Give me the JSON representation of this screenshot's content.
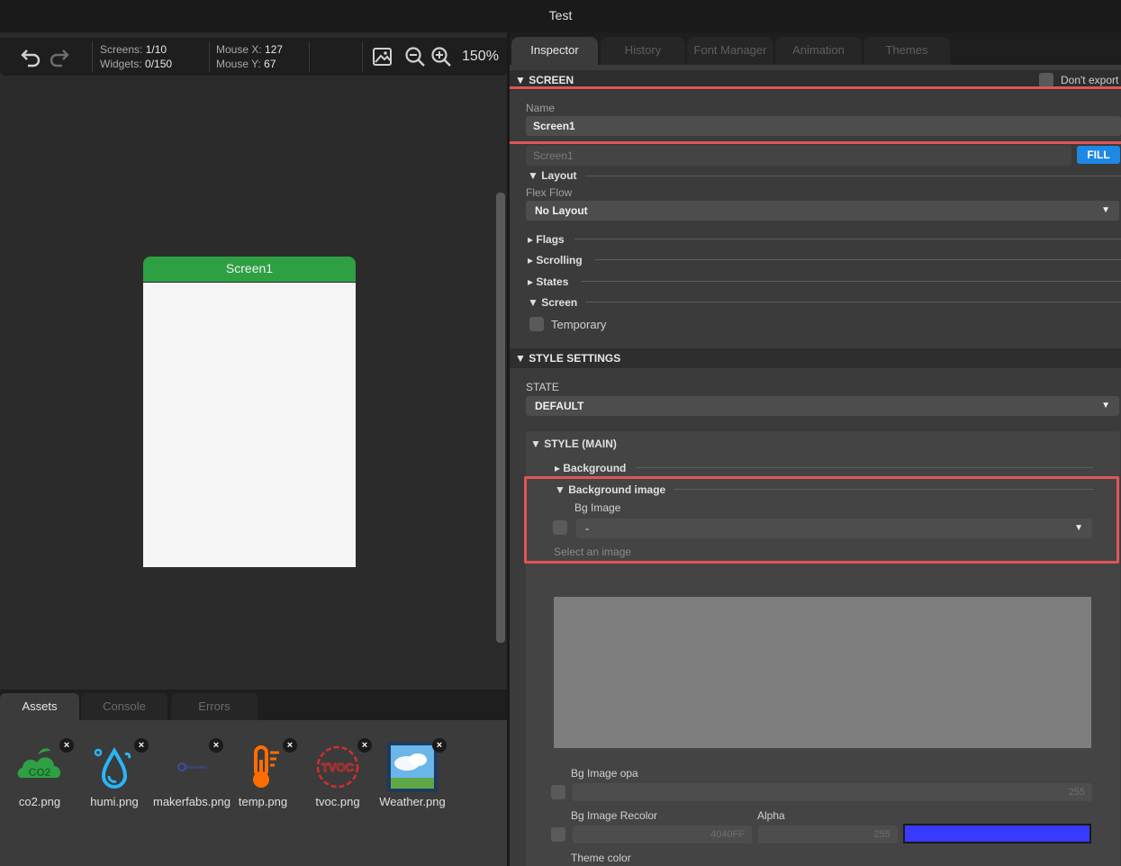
{
  "window": {
    "title": "Test"
  },
  "toolbar": {
    "screens_label": "Screens:",
    "screens_value": "1/10",
    "widgets_label": "Widgets:",
    "widgets_value": "0/150",
    "mouse_x_label": "Mouse X:",
    "mouse_x_value": "127",
    "mouse_y_label": "Mouse Y:",
    "mouse_y_value": "67",
    "zoom": "150%",
    "icons": [
      "undo-icon",
      "redo-icon",
      "image-icon",
      "zoom-out-icon",
      "zoom-in-icon"
    ]
  },
  "canvas": {
    "screen_name": "Screen1",
    "header_color": "#2ea043"
  },
  "bottom": {
    "tabs": [
      "Assets",
      "Console",
      "Errors"
    ],
    "active_tab": "Assets",
    "assets": [
      {
        "name": "co2.png",
        "icon": "co2-icon"
      },
      {
        "name": "humi.png",
        "icon": "humidity-icon"
      },
      {
        "name": "makerfabs.png",
        "icon": "makerfabs-logo-icon"
      },
      {
        "name": "temp.png",
        "icon": "thermometer-icon"
      },
      {
        "name": "tvoc.png",
        "icon": "tvoc-icon"
      },
      {
        "name": "Weather.png",
        "icon": "weather-icon"
      }
    ],
    "makerfabs_logo_text": "Makerfabs",
    "tvoc_logo_text": "TVOC",
    "co2_logo_text": "CO2",
    "close_glyph": "×"
  },
  "inspector": {
    "tabs": [
      "Inspector",
      "History",
      "Font Manager",
      "Animation",
      "Themes"
    ],
    "active_tab": "Inspector",
    "screen_section": "▼ SCREEN",
    "dont_export": "Don't export",
    "name_label": "Name",
    "name_value": "Screen1",
    "name_placeholder": "Screen1",
    "fill_button": "FILL",
    "layout_head": "▼ Layout",
    "flex_flow_label": "Flex Flow",
    "flex_flow_value": "No Layout",
    "flags_head": "▸ Flags",
    "scrolling_head": "▸ Scrolling",
    "states_head": "▸ States",
    "screen_head": "▼ Screen",
    "temporary_label": "Temporary",
    "style_settings": "▼ STYLE SETTINGS",
    "state_label": "STATE",
    "state_value": "DEFAULT",
    "style_main": "▼ STYLE (MAIN)",
    "background_head": "▸ Background",
    "bg_image_head": "▼ Background image",
    "bg_image_label": "Bg Image",
    "bg_image_value": "-",
    "select_image": "Select an image",
    "bg_image_opa_label": "Bg Image opa",
    "bg_image_opa_value": "255",
    "recolor_label": "Bg Image Recolor",
    "recolor_value": "4040FF",
    "alpha_label": "Alpha",
    "alpha_value": "255",
    "theme_color_label": "Theme color",
    "recolor_color": "#3a3aff",
    "dropdown_arrow": "▼"
  }
}
